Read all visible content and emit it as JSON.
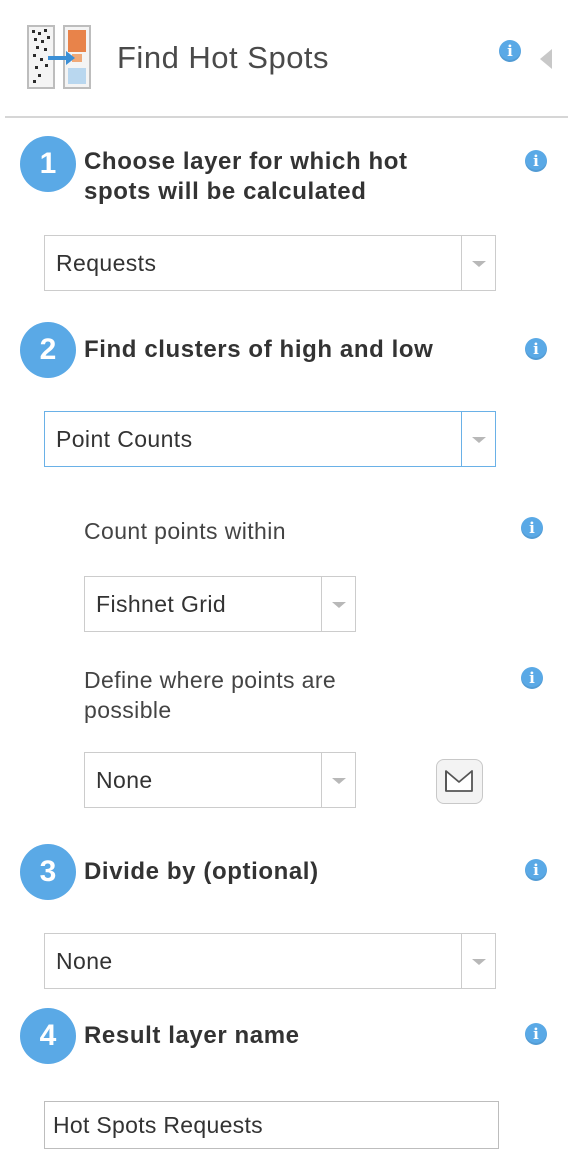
{
  "header": {
    "title": "Find Hot Spots"
  },
  "steps": [
    {
      "number": "1",
      "title_line1": "Choose layer for which hot",
      "title_line2": "spots will be calculated",
      "select_value": "Requests"
    },
    {
      "number": "2",
      "title": "Find clusters of high and low",
      "select_value": "Point Counts",
      "count_within_label": "Count points within",
      "count_within_value": "Fishnet Grid",
      "define_where_line1": "Define where points are",
      "define_where_line2": "possible",
      "define_where_value": "None"
    },
    {
      "number": "3",
      "title": "Divide by (optional)",
      "select_value": "None"
    },
    {
      "number": "4",
      "title": "Result layer name",
      "input_value": "Hot Spots Requests"
    }
  ],
  "icons": {
    "info": "i",
    "tool": "find-hot-spots-icon",
    "collapse": "collapse-arrow-icon",
    "draw": "draw-boundary-icon"
  },
  "colors": {
    "accent": "#5aa9e6",
    "focus_border": "#6ab1e7",
    "tool_icon_orange": "#e8834a"
  }
}
